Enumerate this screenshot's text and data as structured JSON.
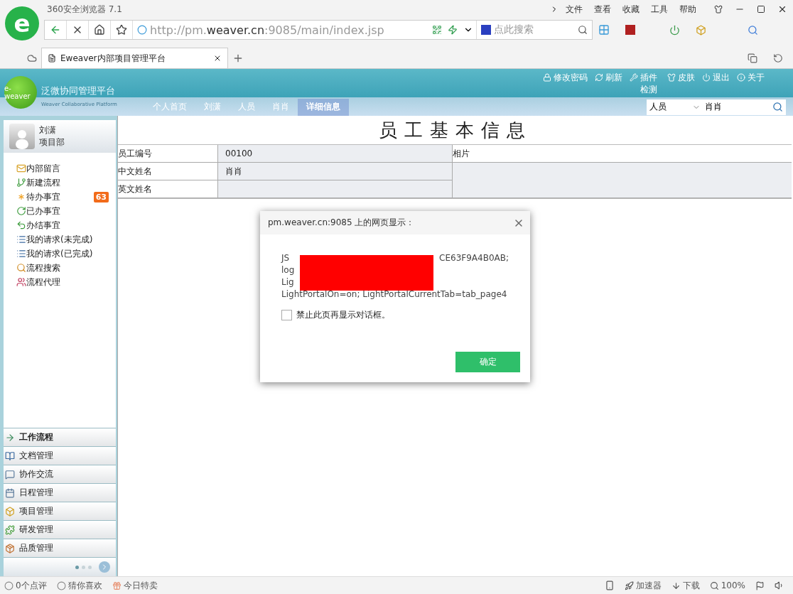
{
  "browser": {
    "logo": "e",
    "title": "360安全浏览器 7.1",
    "menu": [
      "文件",
      "查看",
      "收藏",
      "工具",
      "帮助"
    ],
    "url": {
      "prefix": "http://pm.",
      "domain": "weaver.cn",
      "suffix": ":9085/main/index.jsp"
    },
    "search": {
      "placeholder": "点此搜索"
    },
    "tabs": [
      {
        "label": "Eweaver内部项目管理平台",
        "selected": true
      }
    ]
  },
  "app": {
    "brand": {
      "logo": "e-weaver",
      "title": "泛微协同管理平台",
      "subtitle": "Weaver Collaborative Platform"
    },
    "top_links": [
      {
        "kind": "lock",
        "label": "修改密码"
      },
      {
        "kind": "refresh",
        "label": "刷新"
      },
      {
        "kind": "wrench",
        "label": "插件检测"
      },
      {
        "kind": "skin",
        "label": "皮肤"
      },
      {
        "kind": "power",
        "label": "退出"
      },
      {
        "kind": "info",
        "label": "关于"
      }
    ],
    "nav": [
      {
        "label": "个人首页",
        "selected": false
      },
      {
        "label": "刘潇",
        "selected": false
      },
      {
        "label": "人员",
        "selected": false
      },
      {
        "label": "肖肖",
        "selected": false
      },
      {
        "label": "详细信息",
        "selected": true
      }
    ],
    "search": {
      "category": "人员",
      "value": "肖肖"
    },
    "user": {
      "name": "刘潇",
      "dept": "项目部"
    },
    "menu": [
      {
        "kind": "note",
        "label": "内部留言"
      },
      {
        "kind": "new",
        "label": "新建流程"
      },
      {
        "kind": "todo",
        "label": "待办事宜",
        "badge": "63"
      },
      {
        "kind": "done",
        "label": "已办事宜"
      },
      {
        "kind": "finished",
        "label": "办结事宜"
      },
      {
        "kind": "list",
        "label": "我的请求(未完成)"
      },
      {
        "kind": "list",
        "label": "我的请求(已完成)"
      },
      {
        "kind": "search",
        "label": "流程搜索"
      },
      {
        "kind": "agent",
        "label": "流程代理"
      }
    ],
    "modules": [
      {
        "kind": "flow",
        "label": "工作流程",
        "selected": true
      },
      {
        "kind": "doc",
        "label": "文档管理",
        "selected": false
      },
      {
        "kind": "chat",
        "label": "协作交流",
        "selected": false
      },
      {
        "kind": "calendar",
        "label": "日程管理",
        "selected": false
      },
      {
        "kind": "project",
        "label": "项目管理",
        "selected": false
      },
      {
        "kind": "puzzle",
        "label": "研发管理",
        "selected": false
      },
      {
        "kind": "quality",
        "label": "品质管理",
        "selected": false
      }
    ],
    "pager": [
      {
        "selected": true
      },
      {
        "selected": false
      },
      {
        "selected": false
      }
    ],
    "page_title": "员工基本信息",
    "fields": [
      {
        "label": "员工编号",
        "value": "00100"
      },
      {
        "label": "中文姓名",
        "value": "肖肖"
      },
      {
        "label": "英文姓名"
      }
    ],
    "photo_label": "相片"
  },
  "dialog": {
    "title": "pm.weaver.cn:9085 上的网页显示：",
    "lines": [
      {
        "text": "JS",
        "tail": "CE63F9A4B0AB;"
      },
      {
        "text": "log"
      },
      {
        "text": "Lig"
      },
      {
        "text": "LightPortalOn=on; LightPortalCurrentTab=tab_page4"
      }
    ],
    "redacted": true,
    "checkbox": {
      "label": "禁止此页再显示对话框。",
      "checked": false
    },
    "button": "确定"
  },
  "status_bar": {
    "left": [
      {
        "kind": "comment",
        "label": "0个点评"
      },
      {
        "kind": "like",
        "label": "猜你喜欢"
      },
      {
        "kind": "gift",
        "label": "今日特卖"
      }
    ],
    "right": [
      {
        "kind": "rocket",
        "label": "加速器"
      },
      {
        "kind": "download",
        "label": "下载"
      },
      {
        "kind": "zoom",
        "label": "100%"
      }
    ]
  }
}
